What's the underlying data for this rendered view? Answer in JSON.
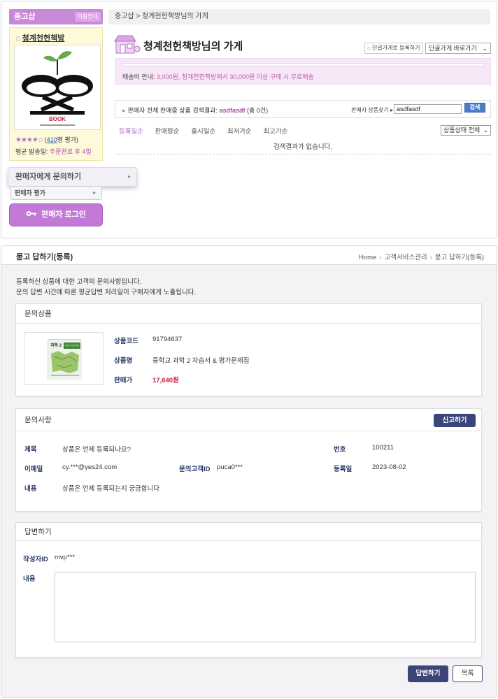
{
  "store_page": {
    "sidebar": {
      "header": "중고샵",
      "guide_button": "이용안내",
      "shop_name": "청계천헌책방",
      "logo_text": "BOOK",
      "rating_stars": 4,
      "rating_count": "410",
      "rating_suffix": "명 평가)",
      "rating_prefix": "(",
      "ship_label": "평균 발송일:",
      "ship_value": "주문완료 후 4일",
      "ask_seller": "판매자에게 문의하기",
      "seller_rating": "판매자 평가",
      "seller_login": "판매자 로그인"
    },
    "breadcrumb": "중고샵 > 청계천헌책방님의 가게",
    "store_title": "청계천헌책방님의 가게",
    "register_fav": "단골가게로 등록하기",
    "goto_fav": "단골가게 바로가기",
    "shipping_label": "배송비 안내:",
    "shipping_info": "3,000원, 청계천헌책방에서 30,000원 이상 구매 시 무료배송",
    "search": {
      "result_prefix": "판매자 전체 판매중 상품 검색결과:",
      "keyword": "asdfasdf",
      "count_text": "(총 0건)",
      "find_label": "판매자 상품찾기 ▸",
      "input_value": "asdfasdf",
      "button": "검색"
    },
    "sort_tabs": [
      "등록일순",
      "판매량순",
      "출시일순",
      "최저가순",
      "최고가순"
    ],
    "active_sort": 0,
    "state_select": "상품상태 전체",
    "empty_message": "검색결과가 없습니다."
  },
  "qa_page": {
    "title": "묻고 답하기(등록)",
    "breadcrumb": [
      "Home",
      "고객서비스관리",
      "묻고 답하기(등록)"
    ],
    "notice_1": "등록하신 상품에 대한 고객의 문의사항입니다.",
    "notice_2": "문의 답변 시간에 따른 평균답변 처리일이 구매자에게 노출됩니다.",
    "product_section": {
      "title": "문의상품",
      "code_label": "상품코드",
      "code": "91794637",
      "name_label": "상품명",
      "name": "중학교 과학 2 자습서 & 평가문제집",
      "price_label": "판매가",
      "price": "17,640원",
      "book_title": "과학 2",
      "book_badge": "자습서 & 평가문제집"
    },
    "inquiry_section": {
      "title": "문의사항",
      "report_button": "신고하기",
      "subject_label": "제목",
      "subject": "상품은 언제 등록되나요?",
      "number_label": "번호",
      "number": "100211",
      "email_label": "이메일",
      "email": "cy.***@yes24.com",
      "customer_label": "문의고객ID",
      "customer": "puca0***",
      "date_label": "등록일",
      "date": "2023-08-02",
      "content_label": "내용",
      "content": "상품은 언제 등록되는지 궁금합니다"
    },
    "answer_section": {
      "title": "답변하기",
      "writer_label": "작성자ID",
      "writer": "mvp***",
      "content_label": "내용",
      "content_value": ""
    },
    "reply_button": "답변하기",
    "list_button": "목록"
  },
  "colors": {
    "accent_purple": "#c88ad8",
    "navy_button": "#3c4578",
    "price_red": "#c0264a",
    "search_blue": "#4b7cc9"
  }
}
